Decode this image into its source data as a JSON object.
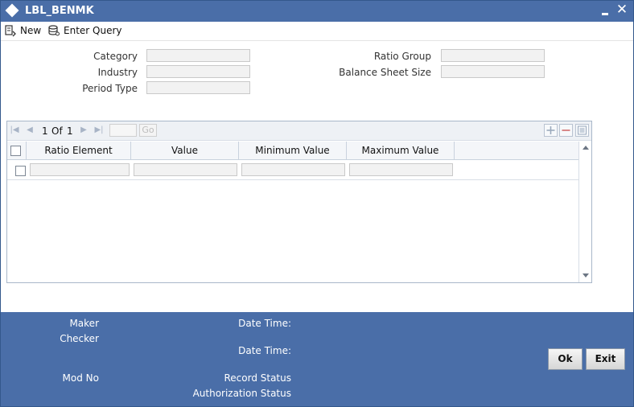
{
  "window": {
    "title": "LBL_BENMK"
  },
  "toolbar": {
    "new_label": "New",
    "enter_query_label": "Enter Query"
  },
  "form": {
    "category_label": "Category",
    "industry_label": "Industry",
    "period_type_label": "Period Type",
    "ratio_group_label": "Ratio Group",
    "balance_sheet_size_label": "Balance Sheet Size"
  },
  "grid": {
    "pagination": {
      "current": "1",
      "of_label": "Of",
      "total": "1",
      "go_label": "Go"
    },
    "columns": [
      "Ratio Element",
      "Value",
      "Minimum Value",
      "Maximum Value"
    ]
  },
  "footer": {
    "maker_label": "Maker",
    "checker_label": "Checker",
    "date_time_label": "Date Time:",
    "mod_no_label": "Mod No",
    "record_status_label": "Record Status",
    "authorization_status_label": "Authorization Status",
    "ok_label": "Ok",
    "exit_label": "Exit"
  },
  "colors": {
    "accent": "#4a6ea8",
    "field_bg": "#f2f2f2"
  }
}
